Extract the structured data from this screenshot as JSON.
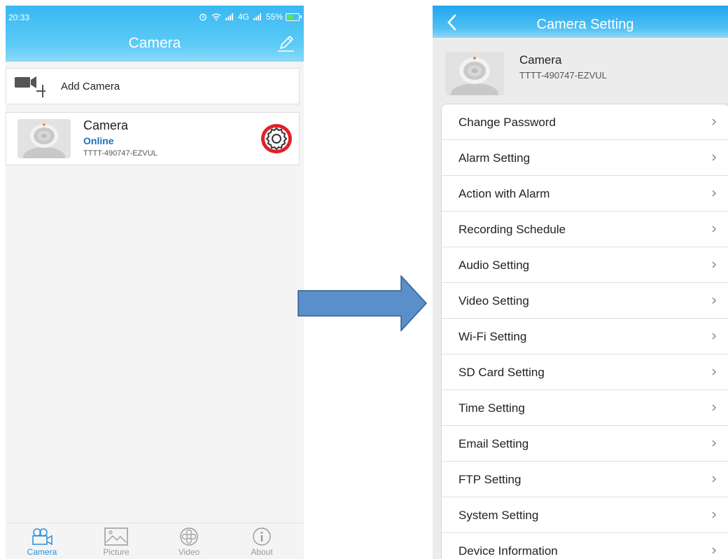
{
  "left_screen": {
    "status_bar": {
      "time": "20:33",
      "network": "4G",
      "battery": "55%"
    },
    "title": "Camera",
    "add_camera_label": "Add Camera",
    "camera": {
      "name": "Camera",
      "status": "Online",
      "uid": "TTTT-490747-EZVUL"
    },
    "tabs": [
      {
        "label": "Camera",
        "icon": "camera-icon",
        "active": true
      },
      {
        "label": "Picture",
        "icon": "picture-icon",
        "active": false
      },
      {
        "label": "Video",
        "icon": "video-icon",
        "active": false
      },
      {
        "label": "About",
        "icon": "info-icon",
        "active": false
      }
    ]
  },
  "right_screen": {
    "title": "Camera Setting",
    "camera": {
      "name": "Camera",
      "uid": "TTTT-490747-EZVUL"
    },
    "menu_items": [
      "Change Password",
      "Alarm Setting",
      "Action with Alarm",
      "Recording Schedule",
      "Audio Setting",
      "Video Setting",
      "Wi-Fi Setting",
      "SD Card Setting",
      "Time Setting",
      "Email Setting",
      "FTP Setting",
      "System Setting",
      "Device Information"
    ]
  },
  "colors": {
    "header_blue": "#39b8f2",
    "online_blue": "#1e6fbd",
    "arrow_fill": "#5b8fc9",
    "gear_highlight": "#e0202a"
  }
}
